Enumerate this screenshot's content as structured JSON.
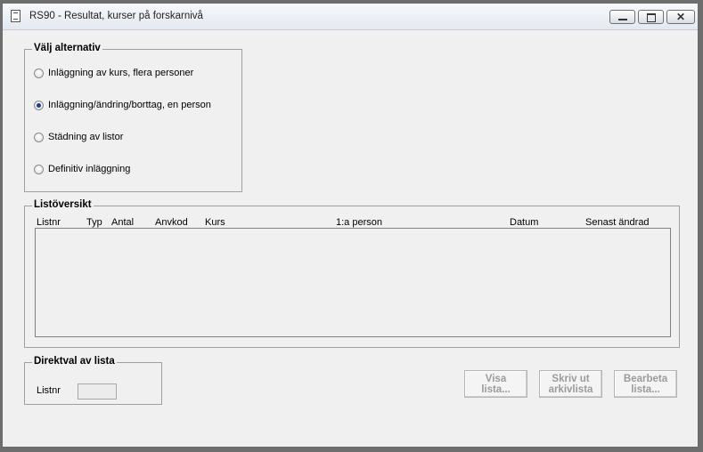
{
  "window": {
    "title": "RS90 - Resultat, kurser på forskarnivå"
  },
  "options_group": {
    "legend": "Välj alternativ",
    "options": [
      {
        "label": "Inläggning av kurs, flera personer",
        "checked": false
      },
      {
        "label": "Inläggning/ändring/borttag, en person",
        "checked": true
      },
      {
        "label": "Städning av listor",
        "checked": false
      },
      {
        "label": "Definitiv inläggning",
        "checked": false
      }
    ]
  },
  "list_overview": {
    "legend": "Listöversikt",
    "columns": [
      "Listnr",
      "Typ",
      "Antal",
      "Anvkod",
      "Kurs",
      "1:a person",
      "Datum",
      "Senast ändrad"
    ]
  },
  "direct_select": {
    "legend": "Direktval av lista",
    "label": "Listnr",
    "value": ""
  },
  "buttons": {
    "view": [
      "Visa",
      "lista..."
    ],
    "print": [
      "Skriv ut",
      "arkivlista"
    ],
    "edit": [
      "Bearbeta",
      "lista..."
    ]
  },
  "icons": {
    "app": "document-icon",
    "minimize": "minimize-icon",
    "maximize": "maximize-icon",
    "close": "close-icon"
  }
}
